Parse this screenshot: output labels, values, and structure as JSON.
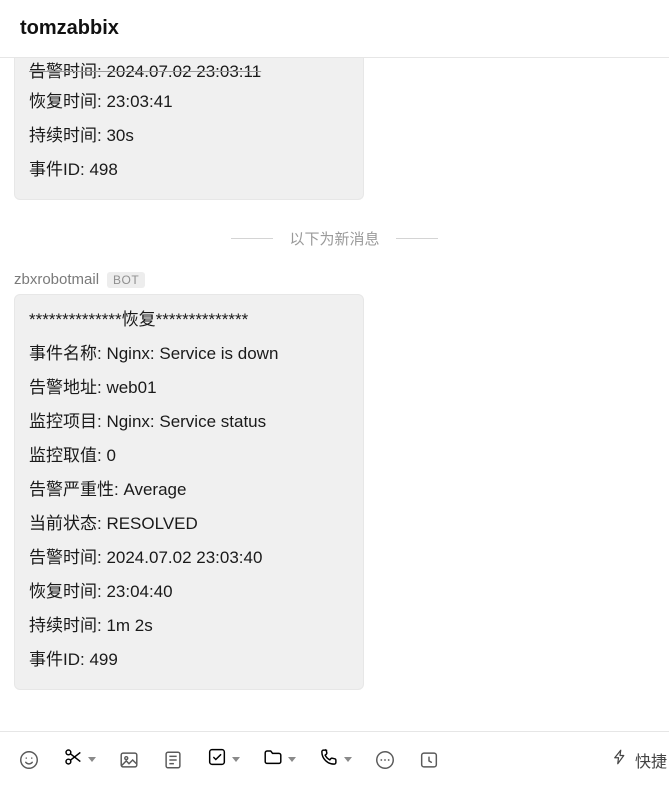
{
  "header": {
    "title": "tomzabbix"
  },
  "topBubble": {
    "cutText": "告警时间:  2024.07.02 23:03:11",
    "rows": [
      "恢复时间:  23:03:41",
      "持续时间:  30s",
      "事件ID:  498"
    ]
  },
  "divider": {
    "label": "以下为新消息"
  },
  "sender": {
    "name": "zbxrobotmail",
    "badge": "BOT"
  },
  "mainBubble": {
    "banner": "**************恢复**************",
    "rows": [
      "事件名称:  Nginx: Service is down",
      "告警地址:  web01",
      "监控项目:  Nginx: Service status",
      "监控取值:  0",
      "告警严重性:  Average",
      "当前状态:  RESOLVED",
      "告警时间:  2024.07.02 23:03:40",
      "恢复时间:  23:04:40",
      "持续时间:  1m 2s",
      "事件ID:  499"
    ]
  },
  "toolbar": {
    "quickSend": "快捷"
  }
}
